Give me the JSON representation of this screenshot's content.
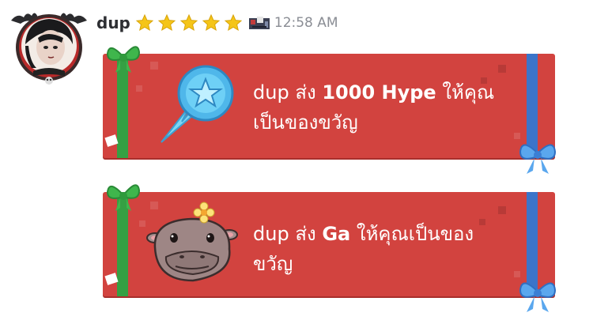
{
  "message": {
    "username": "dup",
    "timestamp": "12:58 AM",
    "star_count": 5
  },
  "gifts": [
    {
      "sender": "dup",
      "verb": "ส่ง",
      "item": "1000 Hype",
      "suffix": "ให้คุณเป็นของขวัญ",
      "icon": "hype-comet-icon"
    },
    {
      "sender": "dup",
      "verb": "ส่ง",
      "item": "Ga",
      "suffix": "ให้คุณเป็นของขวัญ",
      "icon": "ga-hippo-icon"
    }
  ],
  "colors": {
    "card_red": "#d2433f",
    "ribbon_green": "#35a043",
    "ribbon_blue": "#3b74c9",
    "star_yellow": "#f5c518",
    "timestamp_gray": "#8a8d94"
  }
}
